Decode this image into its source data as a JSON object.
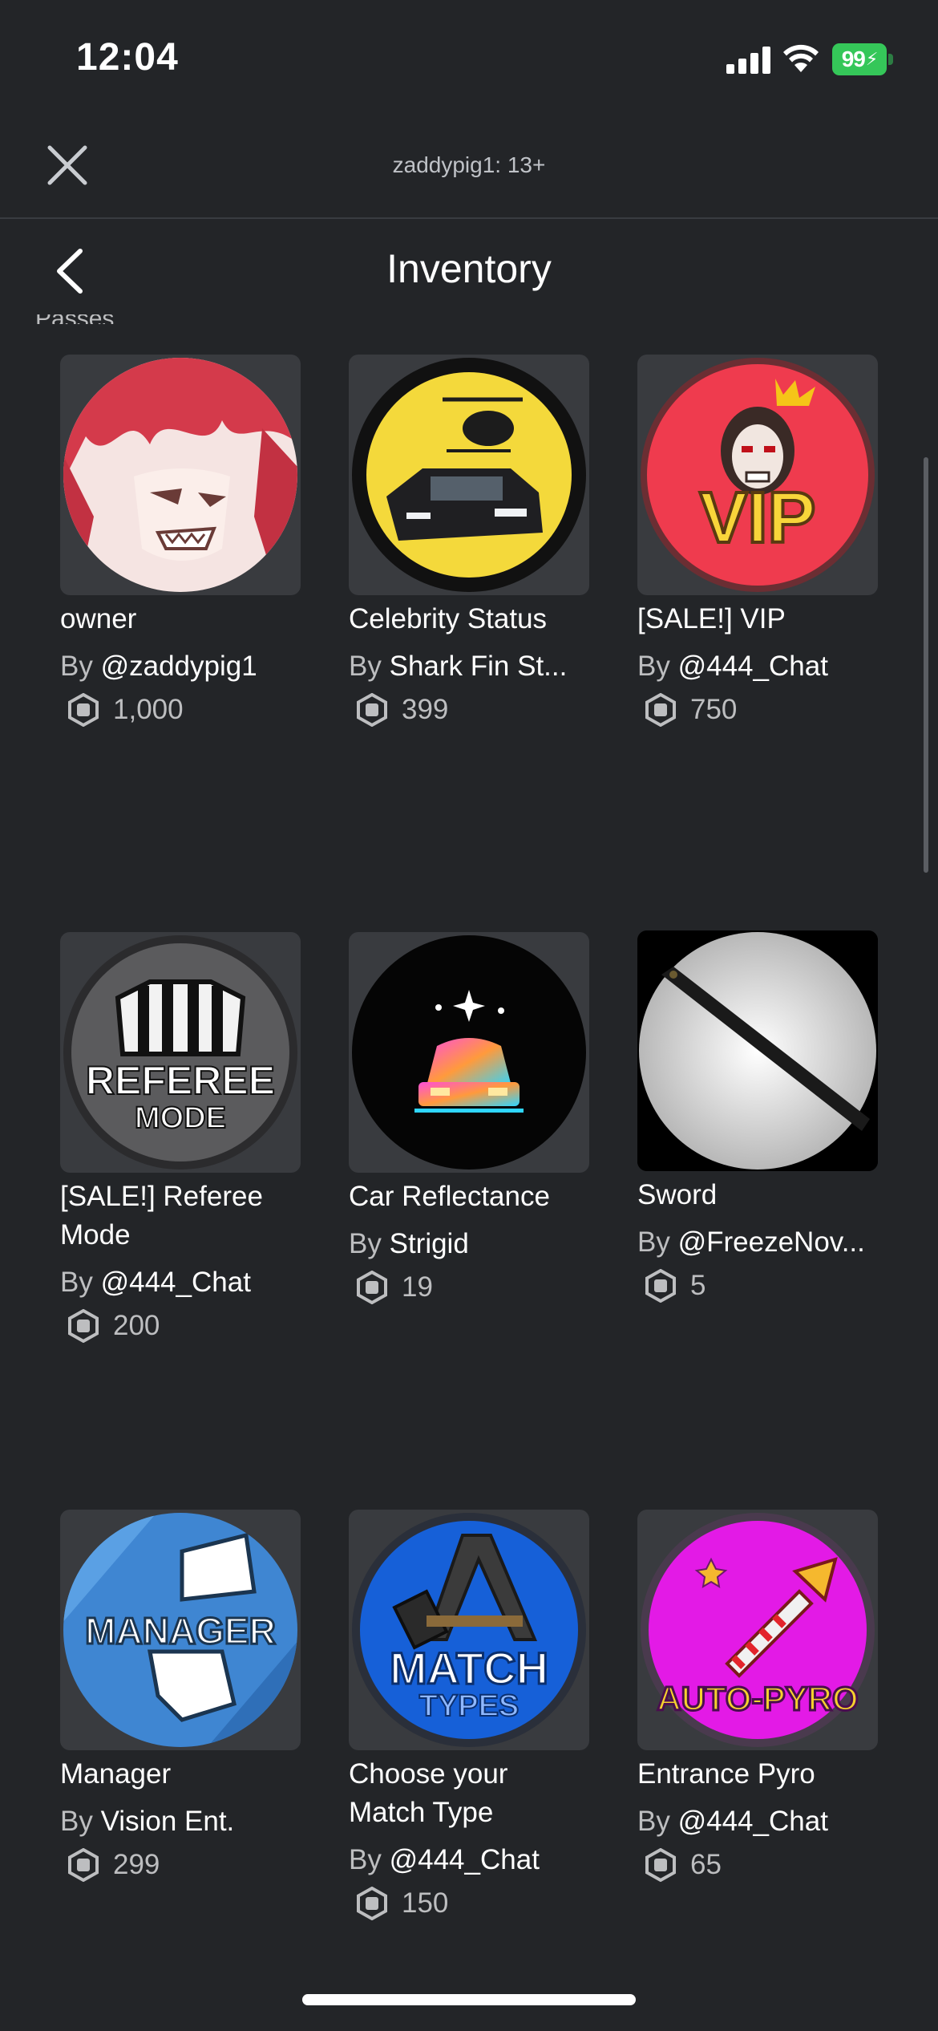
{
  "status_bar": {
    "time": "12:04",
    "battery": "99"
  },
  "top_bar": {
    "experience_name": "zaddypig1: 13+"
  },
  "header": {
    "title": "Inventory"
  },
  "section": {
    "peek_label": "Passes"
  },
  "colors": {
    "background": "#232528",
    "thumb_bg": "#393b3f",
    "muted_text": "#bdbec0",
    "battery": "#35c759"
  },
  "items": [
    {
      "name": "owner",
      "by": "By",
      "creator": "@zaddypig1",
      "price": "1,000",
      "icon": "anime-avatar-icon"
    },
    {
      "name": "Celebrity Status",
      "by": "By",
      "creator": "Shark Fin St...",
      "price": "399",
      "icon": "celebrity-car-helicopter-icon"
    },
    {
      "name": "[SALE!] VIP",
      "by": "By",
      "creator": "@444_Chat",
      "price": "750",
      "icon": "vip-badge-icon"
    },
    {
      "name": "[SALE!] Referee Mode",
      "by": "By",
      "creator": "@444_Chat",
      "price": "200",
      "icon": "referee-mode-icon"
    },
    {
      "name": "Car Reflectance",
      "by": "By",
      "creator": "Strigid",
      "price": "19",
      "icon": "neon-car-icon"
    },
    {
      "name": "Sword",
      "by": "By",
      "creator": "@FreezeNov...",
      "price": "5",
      "icon": "sword-icon"
    },
    {
      "name": "Manager",
      "by": "By",
      "creator": "Vision Ent.",
      "price": "299",
      "icon": "manager-megaphone-icon"
    },
    {
      "name": "Choose your Match Type",
      "by": "By",
      "creator": "@444_Chat",
      "price": "150",
      "icon": "match-types-icon"
    },
    {
      "name": "Entrance Pyro",
      "by": "By",
      "creator": "@444_Chat",
      "price": "65",
      "icon": "auto-pyro-icon"
    }
  ],
  "thumb_text": {
    "vip": "VIP",
    "referee_line1": "REFEREE",
    "referee_line2": "MODE",
    "manager": "MANAGER",
    "match_line1": "MATCH",
    "match_line2": "TYPES",
    "pyro": "AUTO-PYRO"
  }
}
